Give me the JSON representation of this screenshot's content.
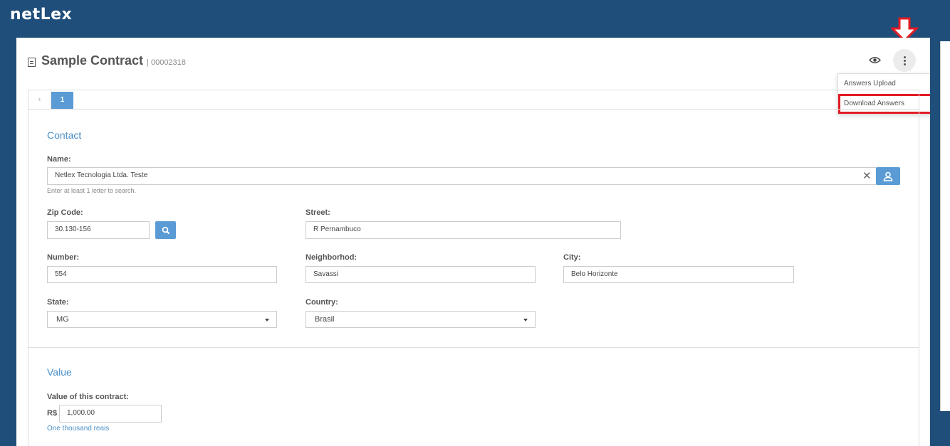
{
  "app": {
    "logo": "netLex"
  },
  "header": {
    "title": "Sample Contract",
    "code": "| 00002318"
  },
  "menu": {
    "items": [
      "Answers Upload",
      "Download Answers"
    ]
  },
  "pager": {
    "prev": "‹",
    "page": "1"
  },
  "contact": {
    "section": "Contact",
    "name_label": "Name:",
    "name_value": "Netlex Tecnologia Ltda. Teste",
    "name_hint": "Enter at least 1 letter to search.",
    "zip_label": "Zip Code:",
    "zip_value": "30.130-156",
    "street_label": "Street:",
    "street_value": "R Pernambuco",
    "number_label": "Number:",
    "number_value": "554",
    "neighborhood_label": "Neighborhod:",
    "neighborhood_value": "Savassi",
    "city_label": "City:",
    "city_value": "Belo Horizonte",
    "state_label": "State:",
    "state_value": "MG",
    "country_label": "Country:",
    "country_value": "Brasil"
  },
  "value": {
    "section": "Value",
    "label": "Value of this contract:",
    "currency": "R$",
    "amount": "1,000.00",
    "words": "One thousand reais"
  },
  "colors": {
    "header_bg": "#1f4e7a",
    "accent": "#5b9bd5",
    "highlight": "#e31b23"
  }
}
